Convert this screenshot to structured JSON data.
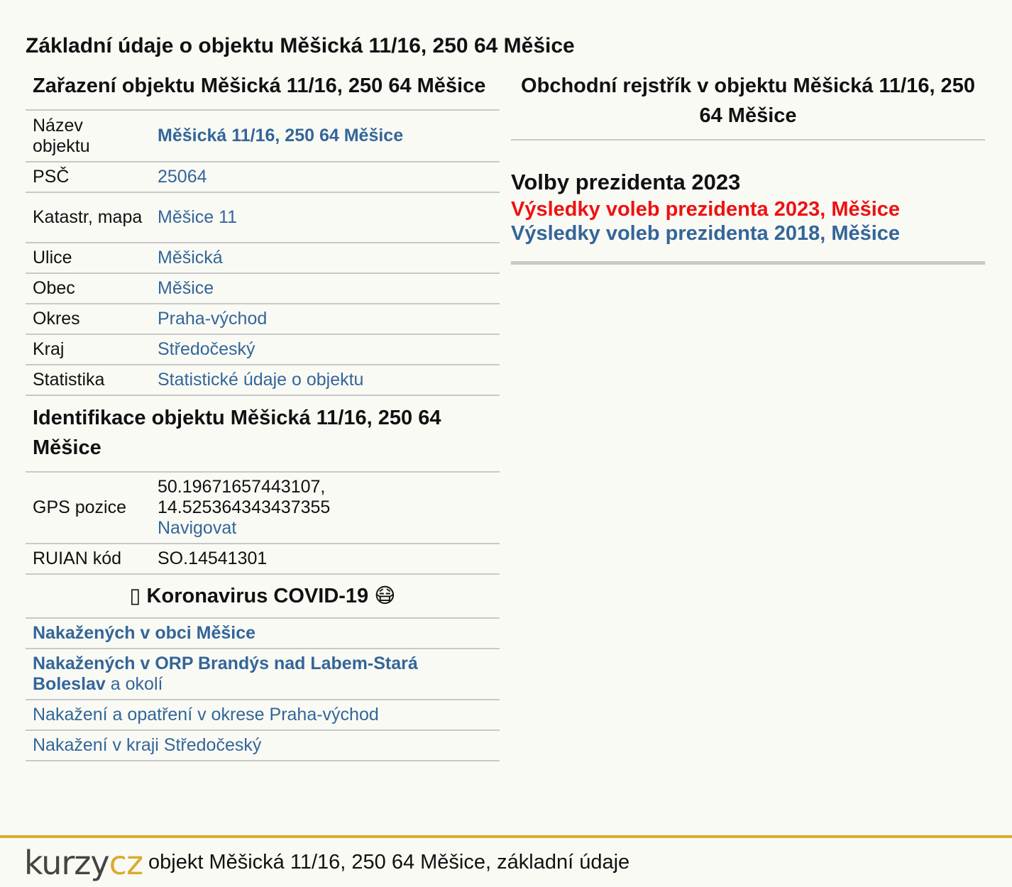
{
  "page_title": "Základní údaje o objektu Měšická 11/16, 250 64 Měšice",
  "zarazeni": {
    "heading": "Zařazení objektu Měšická 11/16, 250 64 Měšice",
    "rows": [
      {
        "label": "Název objektu",
        "value": "Měšická 11/16, 250 64 Měšice"
      },
      {
        "label": "PSČ",
        "value": "25064"
      },
      {
        "label": "Katastr, mapa",
        "value": "Měšice 11"
      },
      {
        "label": "Ulice",
        "value": "Měšická"
      },
      {
        "label": "Obec",
        "value": "Měšice"
      },
      {
        "label": "Okres",
        "value": "Praha-východ"
      },
      {
        "label": "Kraj",
        "value": "Středočeský"
      },
      {
        "label": "Statistika",
        "value": "Statistické údaje o objektu"
      }
    ]
  },
  "identifikace": {
    "heading": "Identifikace objektu Měšická 11/16, 250 64 Měšice",
    "gps_label": "GPS pozice",
    "gps_lat": "50.19671657443107,",
    "gps_lon": "14.525364343437355",
    "gps_link": "Navigovat",
    "ruian_label": "RUIAN kód",
    "ruian_value": "SO.14541301"
  },
  "covid": {
    "heading": "Koronavirus COVID-19",
    "heading_prefix": "▯",
    "heading_suffix": "😷",
    "links": [
      {
        "text": "Nakažených v obci Měšice",
        "tail": ""
      },
      {
        "text": "Nakažených v ORP Brandýs nad Labem-Stará Boleslav",
        "tail": " a okolí"
      },
      {
        "text": "Nakažení a opatření v okrese Praha-východ",
        "tail": ""
      },
      {
        "text": "Nakažení v kraji Středočeský",
        "tail": ""
      }
    ]
  },
  "right": {
    "heading": "Obchodní rejstřík v objektu Měšická 11/16, 250 64 Měšice",
    "volby_title": "Volby prezidenta 2023",
    "volby_link_2023": "Výsledky voleb prezidenta 2023, Měšice",
    "volby_link_2018": "Výsledky voleb prezidenta 2018, Měšice"
  },
  "footer": {
    "logo_kurzy": "kurzy",
    "logo_cz": "cz",
    "text": "objekt Měšická 11/16, 250 64 Měšice, základní údaje"
  },
  "colors": {
    "link": "#336699",
    "link_highlight": "#ee1111",
    "footer_accent": "#d9ab2f",
    "background": "#fafaf5"
  }
}
